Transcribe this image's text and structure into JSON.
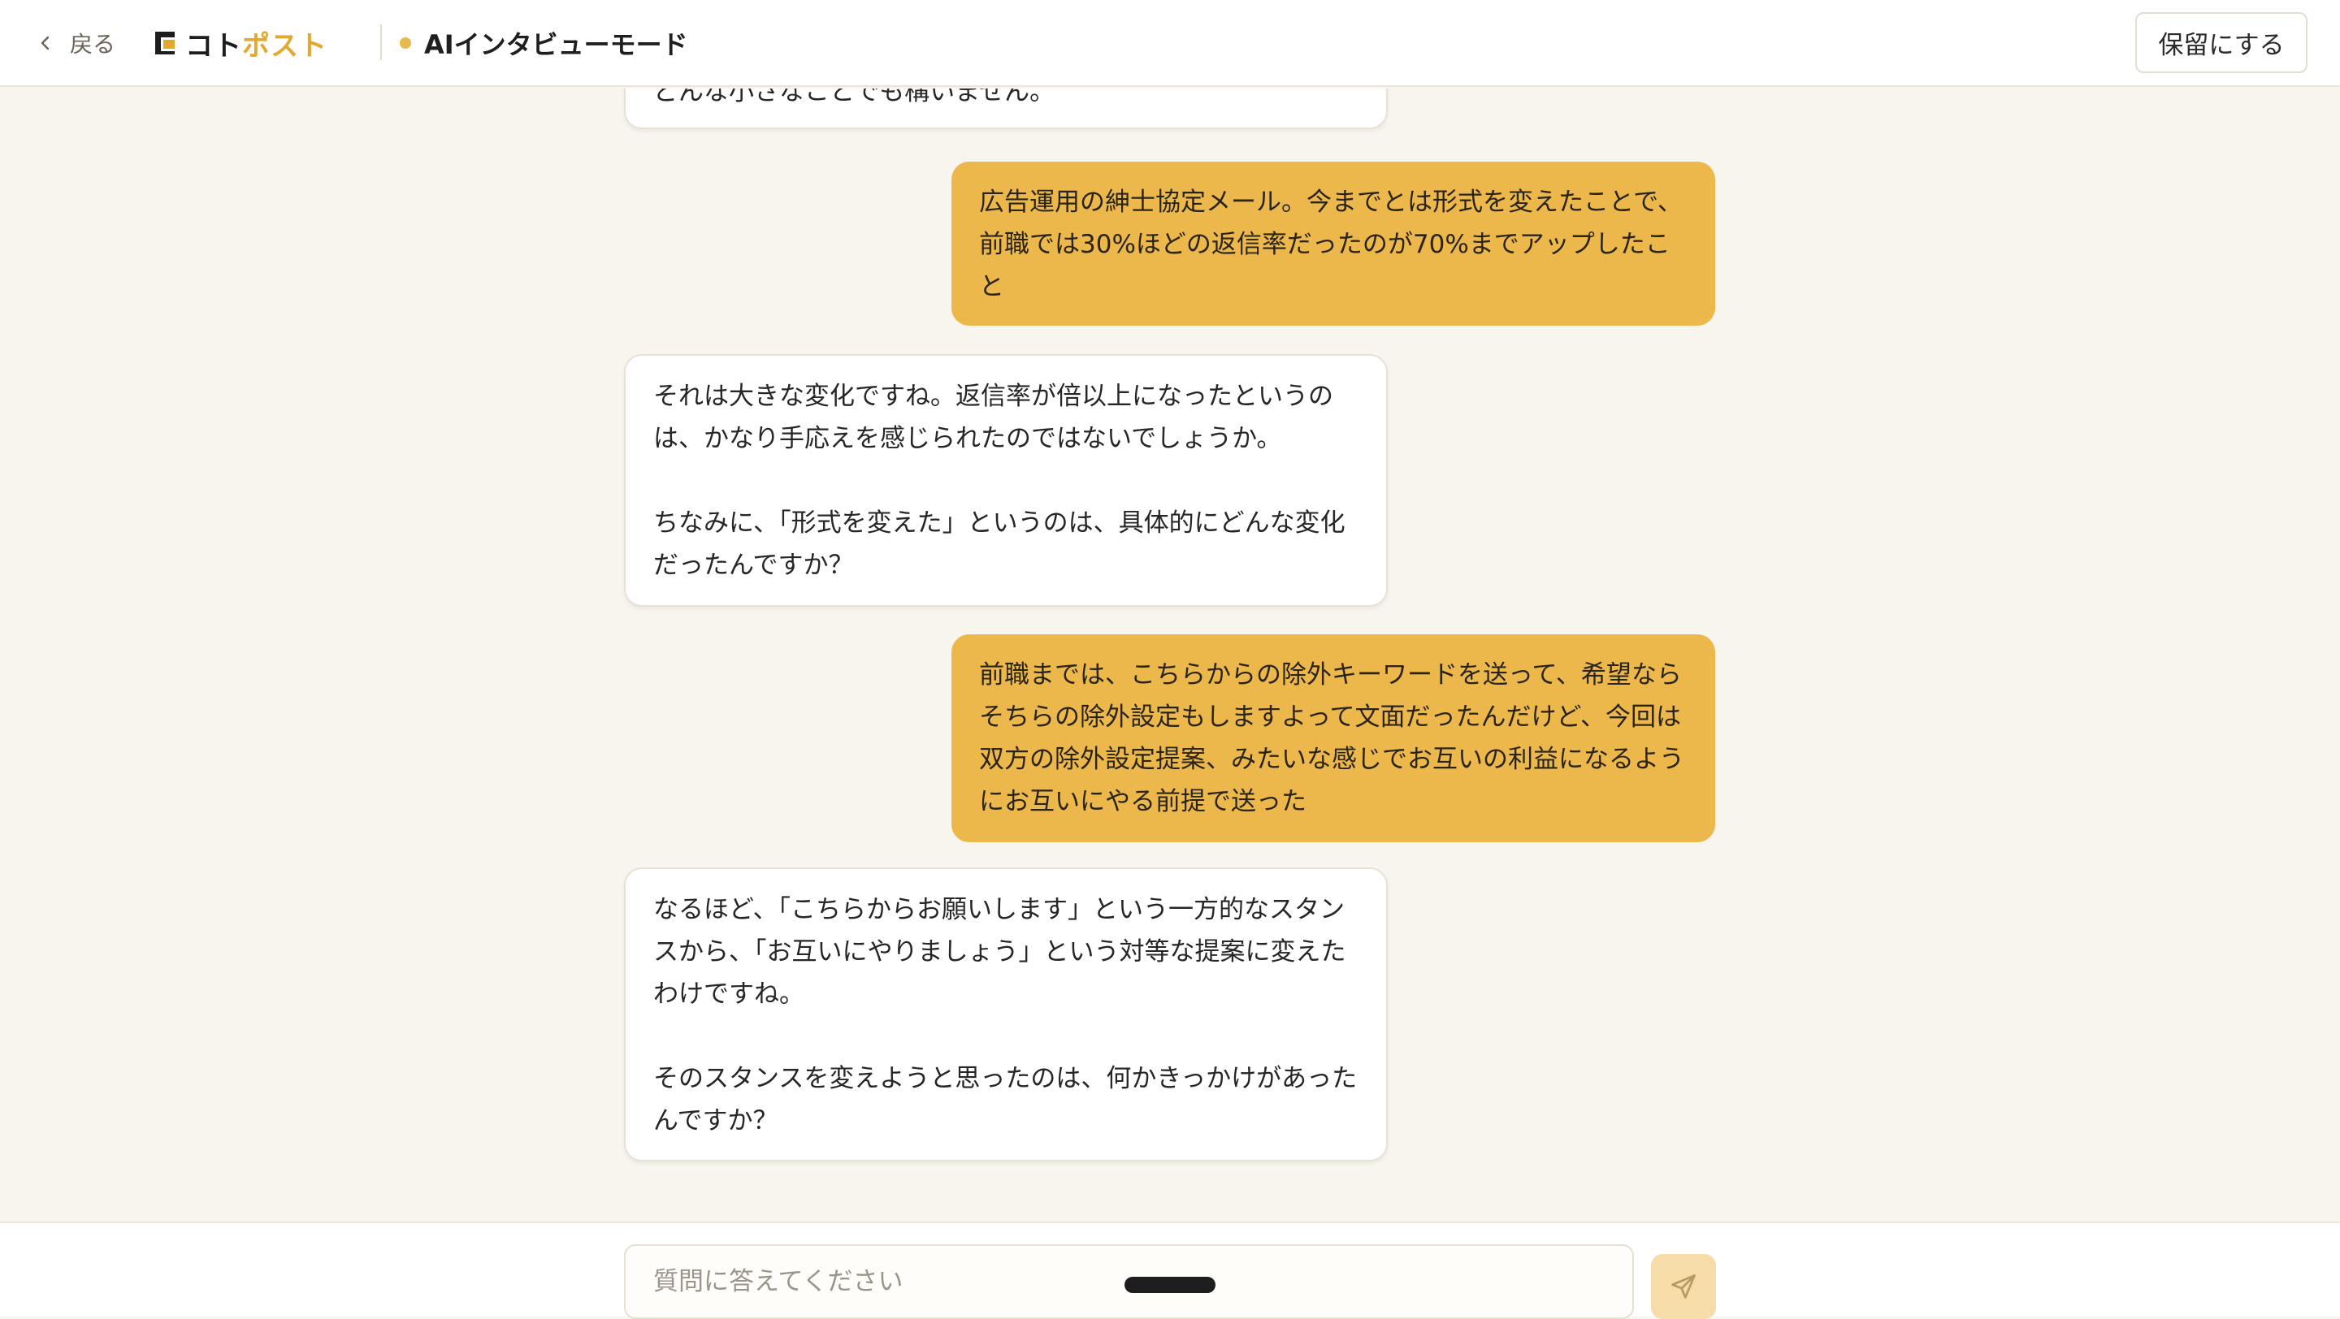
{
  "header": {
    "back_label": "戻る",
    "logo_text_main": "コト",
    "logo_text_accent": "ポスト",
    "mode_label": "AIインタビューモード",
    "hold_button_label": "保留にする"
  },
  "colors": {
    "accent": "#ecb84b",
    "background": "#f8f5ef",
    "ai_bubble": "#ffffff",
    "send_button": "#f6dca8"
  },
  "messages": [
    {
      "role": "ai",
      "text": "どんな小さなことでも構いません。"
    },
    {
      "role": "user",
      "text": "広告運用の紳士協定メール。今までとは形式を変えたことで、前職では30%ほどの返信率だったのが70%までアップしたこと"
    },
    {
      "role": "ai",
      "text": "それは大きな変化ですね。返信率が倍以上になったというのは、かなり手応えを感じられたのではないでしょうか。\n\nちなみに、「形式を変えた」というのは、具体的にどんな変化だったんですか？"
    },
    {
      "role": "user",
      "text": "前職までは、こちらからの除外キーワードを送って、希望ならそちらの除外設定もしますよって文面だったんだけど、今回は双方の除外設定提案、みたいな感じでお互いの利益になるようにお互いにやる前提で送った"
    },
    {
      "role": "ai",
      "text": "なるほど、「こちらからお願いします」という一方的なスタンスから、「お互いにやりましょう」という対等な提案に変えたわけですね。\n\nそのスタンスを変えようと思ったのは、何かきっかけがあったんですか？"
    }
  ],
  "composer": {
    "placeholder": "質問に答えてください",
    "send_icon": "paper-plane-icon"
  }
}
